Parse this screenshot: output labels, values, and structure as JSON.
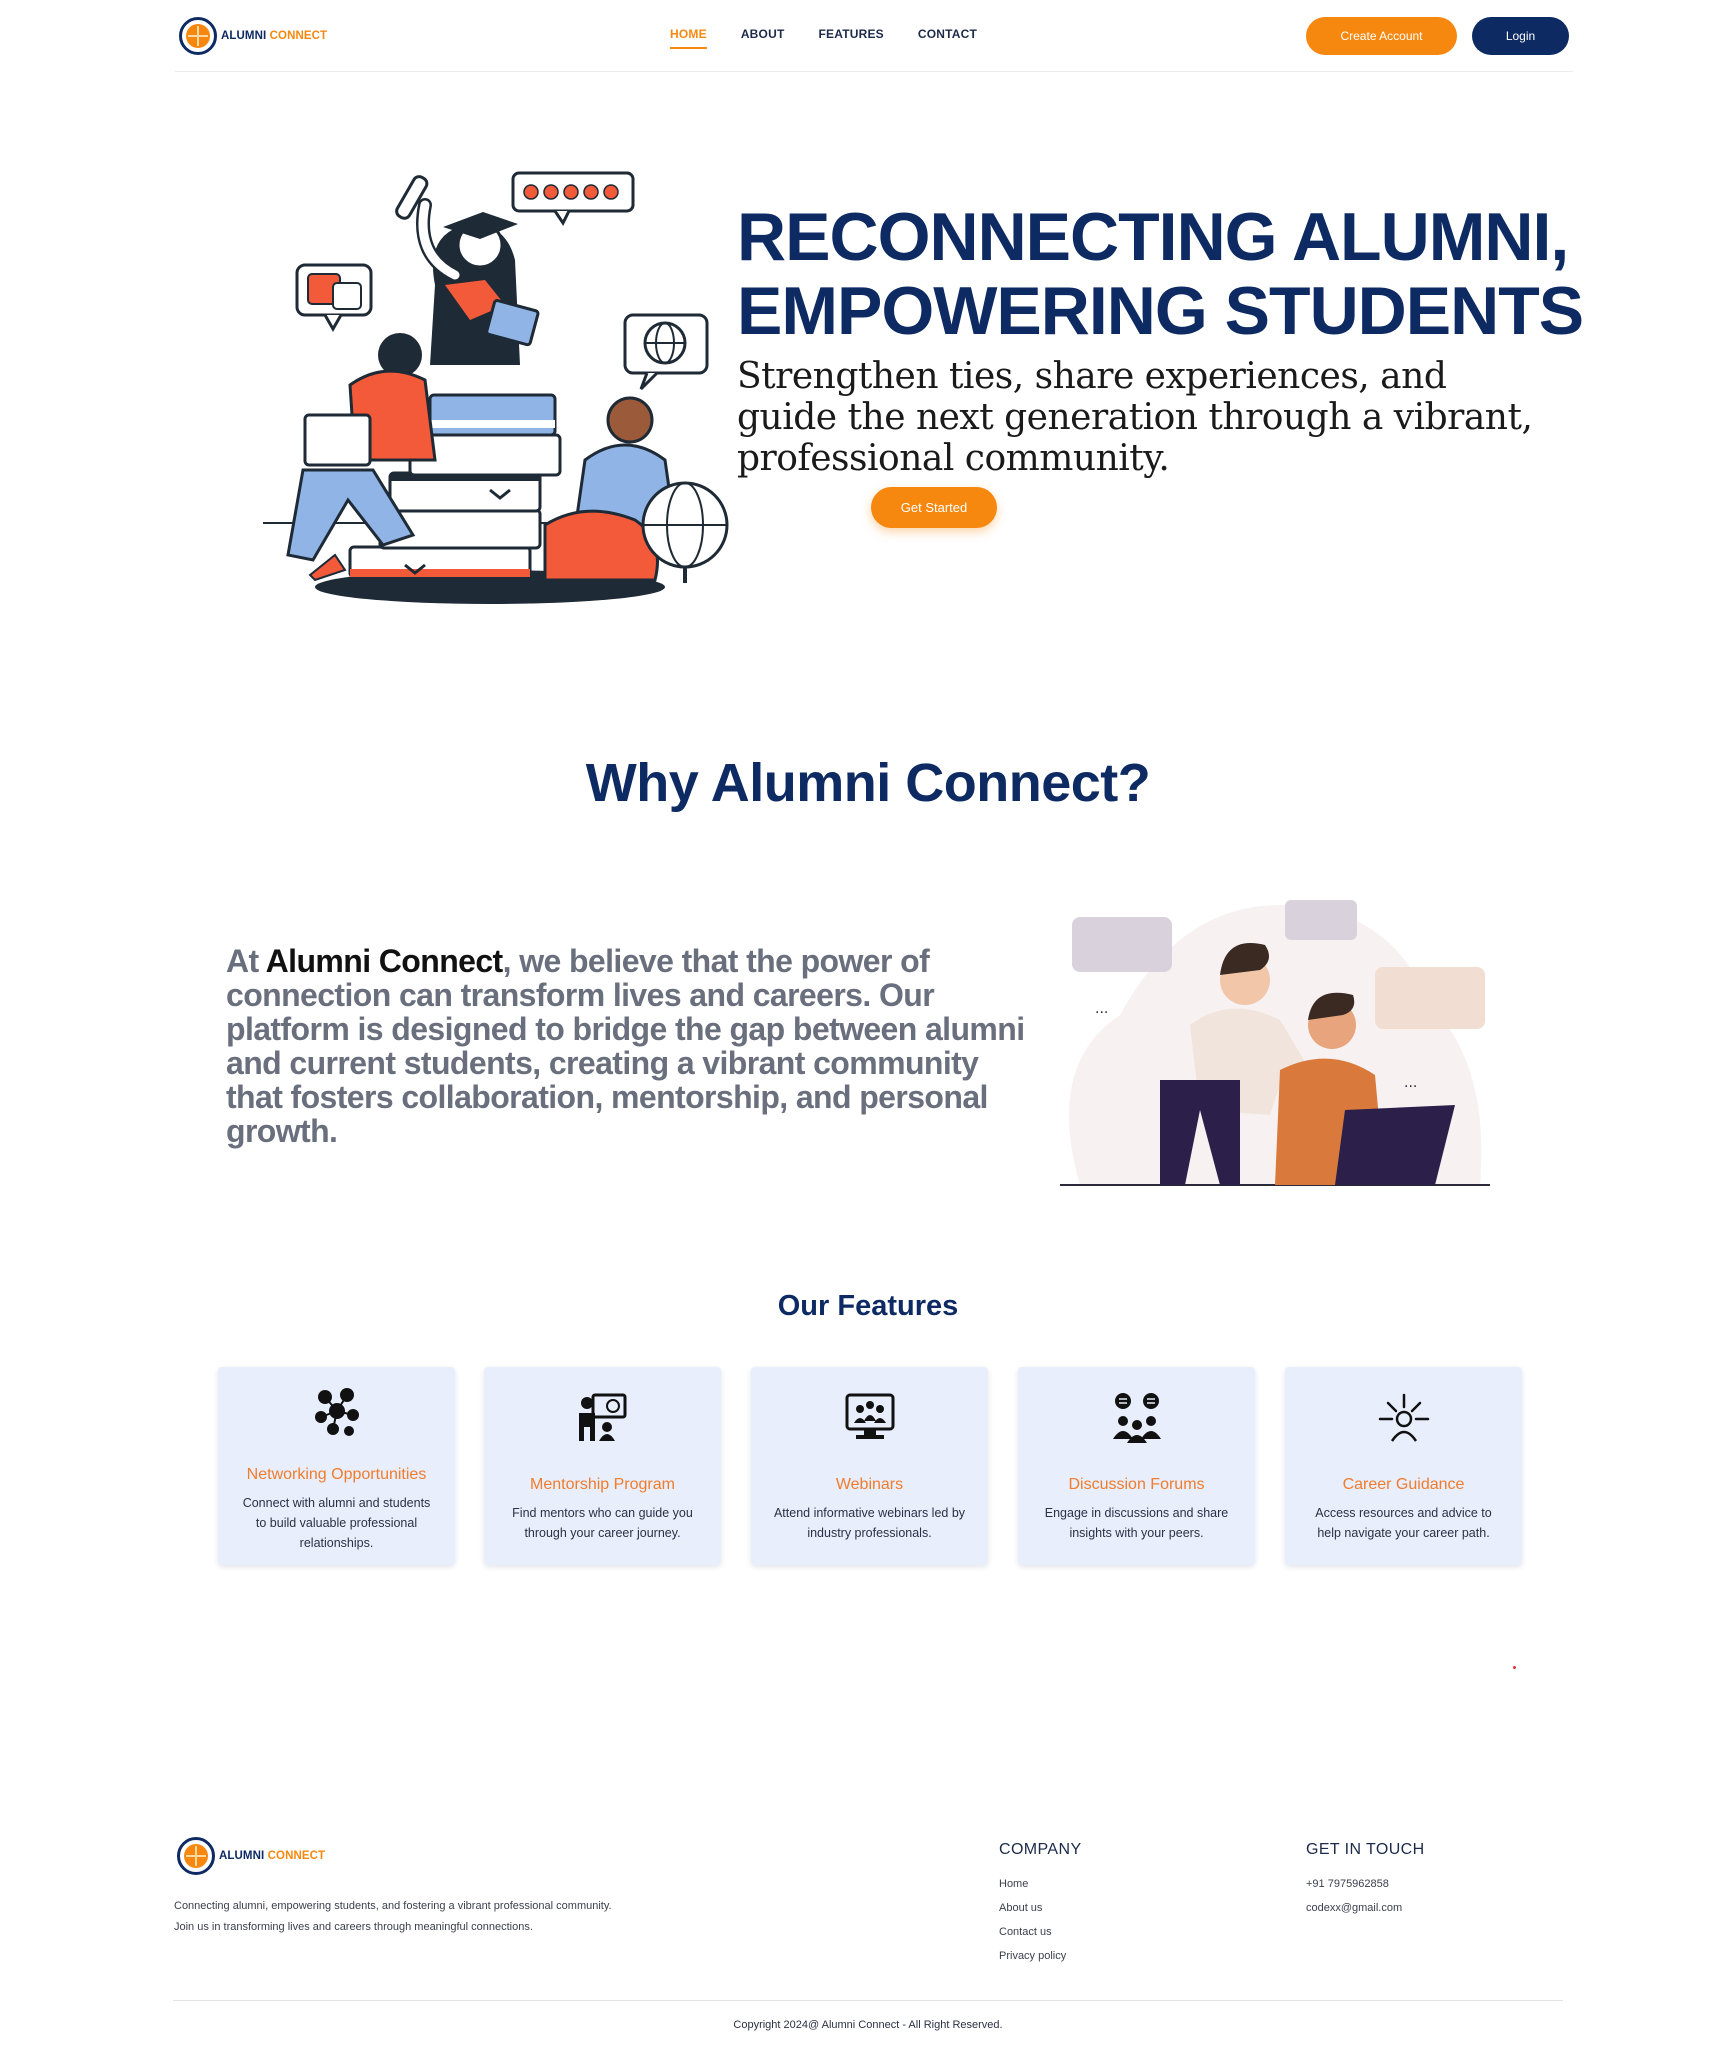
{
  "brand": {
    "word1": "ALUMNI",
    "word2": "CONNECT"
  },
  "nav": {
    "items": [
      {
        "label": "HOME",
        "active": true
      },
      {
        "label": "ABOUT",
        "active": false
      },
      {
        "label": "FEATURES",
        "active": false
      },
      {
        "label": "CONTACT",
        "active": false
      }
    ],
    "create_account": "Create Account",
    "login": "Login"
  },
  "hero": {
    "title_line1": "RECONNECTING ALUMNI,",
    "title_line2": "EMPOWERING STUDENTS",
    "subtitle_line1": "Strengthen ties, share experiences, and",
    "subtitle_line2": "guide the next generation through a vibrant,",
    "subtitle_line3": "professional community.",
    "cta": "Get Started"
  },
  "why": {
    "title": "Why Alumni Connect?",
    "text_before": "At ",
    "text_brand": "Alumni Connect",
    "text_after": ", we believe that the power of connection can transform lives and careers. Our platform is designed to bridge the gap between alumni and current students, creating a vibrant community that fosters collaboration, mentorship, and personal growth."
  },
  "features": {
    "title": "Our Features",
    "items": [
      {
        "icon": "network-icon",
        "title": "Networking Opportunities",
        "desc": "Connect with alumni and students to build valuable professional relationships."
      },
      {
        "icon": "mentor-icon",
        "title": "Mentorship Program",
        "desc": "Find mentors who can guide you through your career journey."
      },
      {
        "icon": "webinar-icon",
        "title": "Webinars",
        "desc": "Attend informative webinars led by industry professionals."
      },
      {
        "icon": "forum-icon",
        "title": "Discussion Forums",
        "desc": "Engage in discussions and share insights with your peers."
      },
      {
        "icon": "career-icon",
        "title": "Career Guidance",
        "desc": "Access resources and advice to help navigate your career path."
      }
    ]
  },
  "footer": {
    "about_line1": "Connecting alumni, empowering students, and fostering a vibrant professional community.",
    "about_line2": "Join us in transforming lives and careers through meaningful connections.",
    "company_title": "COMPANY",
    "company_links": [
      "Home",
      "About us",
      "Contact us",
      "Privacy policy"
    ],
    "contact_title": "GET IN TOUCH",
    "phone": "+91 7975962858",
    "email": "codexx@gmail.com",
    "copyright": "Copyright 2024@ Alumni Connect - All Right Reserved."
  },
  "colors": {
    "navy": "#0d2a63",
    "orange": "#f7880f",
    "card_bg": "#e8eefc",
    "feature_title": "#f07c2c"
  }
}
